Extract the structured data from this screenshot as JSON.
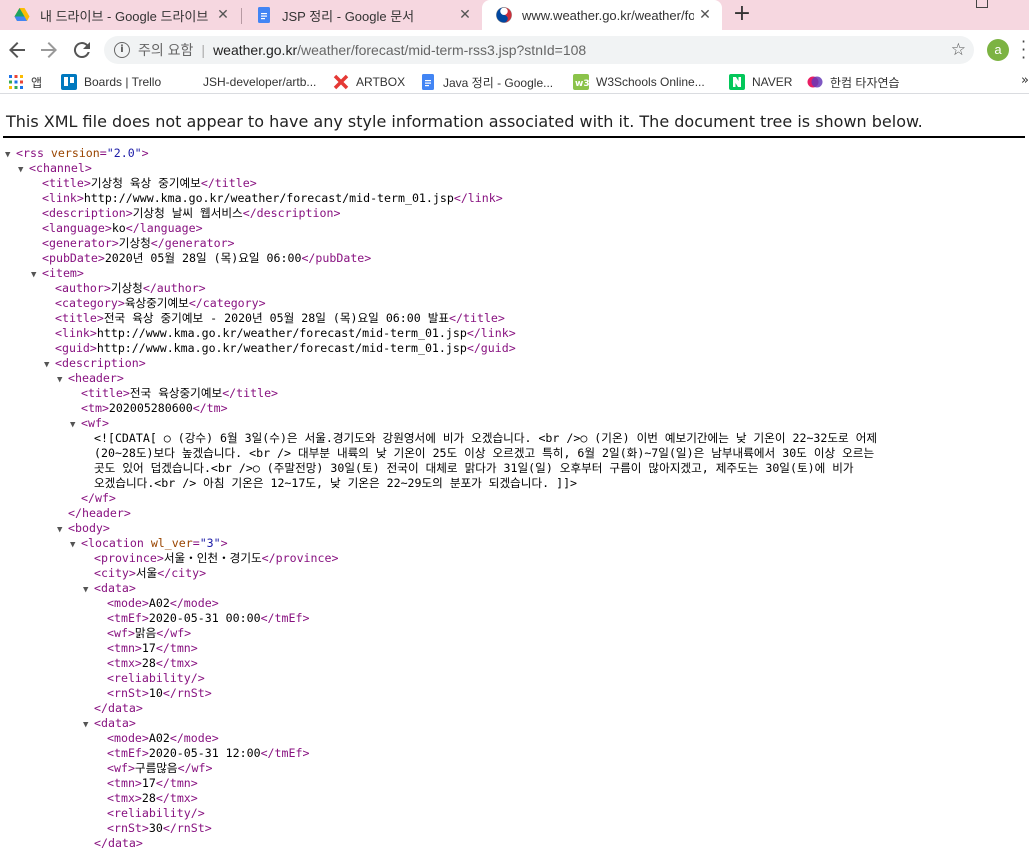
{
  "tabs": [
    {
      "title": "내 드라이브 - Google 드라이브",
      "icon": "google-drive-icon"
    },
    {
      "title": "JSP 정리 - Google 문서",
      "icon": "google-docs-icon"
    },
    {
      "title": "www.weather.go.kr/weather/fore",
      "icon": "chrome-page-icon"
    }
  ],
  "tab_close": "✕",
  "new_tab": "+",
  "omnibox": {
    "security_text": "주의 요함",
    "separator": "|",
    "host": "weather.go.kr",
    "path": "/weather/forecast/mid-term-rss3.jsp?stnId=108"
  },
  "profile_initial": "a",
  "bookmarks": [
    {
      "label": "앱",
      "icon": "apps-grid-icon"
    },
    {
      "label": "Boards | Trello",
      "icon": "trello-icon"
    },
    {
      "label": "JSH-developer/artb...",
      "icon": "github-icon"
    },
    {
      "label": "ARTBOX",
      "icon": "artbox-icon"
    },
    {
      "label": "Java 정리 - Google...",
      "icon": "google-docs-icon"
    },
    {
      "label": "W3Schools Online...",
      "icon": "w3schools-icon"
    },
    {
      "label": "NAVER",
      "icon": "naver-icon"
    },
    {
      "label": "한컴 타자연습",
      "icon": "hancom-icon"
    }
  ],
  "bookmarks_more": "»",
  "banner": "This XML file does not appear to have any style information associated with it. The document tree is shown below.",
  "xml_lines": [
    {
      "arrow": true,
      "indent": 0,
      "parts": [
        [
          "tg",
          "<rss "
        ],
        [
          "at",
          "version"
        ],
        [
          "tg",
          "="
        ],
        [
          "av",
          "\"2.0\""
        ],
        [
          "tg",
          ">"
        ]
      ]
    },
    {
      "arrow": true,
      "indent": 1,
      "parts": [
        [
          "tg",
          "<channel>"
        ]
      ]
    },
    {
      "arrow": false,
      "indent": 2,
      "parts": [
        [
          "tg",
          "<title>"
        ],
        [
          "tx",
          "기상청 육상 중기예보"
        ],
        [
          "tg",
          "</title>"
        ]
      ]
    },
    {
      "arrow": false,
      "indent": 2,
      "parts": [
        [
          "tg",
          "<link>"
        ],
        [
          "tx",
          "http://www.kma.go.kr/weather/forecast/mid-term_01.jsp"
        ],
        [
          "tg",
          "</link>"
        ]
      ]
    },
    {
      "arrow": false,
      "indent": 2,
      "parts": [
        [
          "tg",
          "<description>"
        ],
        [
          "tx",
          "기상청 날씨 웹서비스"
        ],
        [
          "tg",
          "</description>"
        ]
      ]
    },
    {
      "arrow": false,
      "indent": 2,
      "parts": [
        [
          "tg",
          "<language>"
        ],
        [
          "tx",
          "ko"
        ],
        [
          "tg",
          "</language>"
        ]
      ]
    },
    {
      "arrow": false,
      "indent": 2,
      "parts": [
        [
          "tg",
          "<generator>"
        ],
        [
          "tx",
          "기상청"
        ],
        [
          "tg",
          "</generator>"
        ]
      ]
    },
    {
      "arrow": false,
      "indent": 2,
      "parts": [
        [
          "tg",
          "<pubDate>"
        ],
        [
          "tx",
          "2020년 05월 28일 (목)요일 06:00"
        ],
        [
          "tg",
          "</pubDate>"
        ]
      ]
    },
    {
      "arrow": true,
      "indent": 2,
      "parts": [
        [
          "tg",
          "<item>"
        ]
      ]
    },
    {
      "arrow": false,
      "indent": 3,
      "parts": [
        [
          "tg",
          "<author>"
        ],
        [
          "tx",
          "기상청"
        ],
        [
          "tg",
          "</author>"
        ]
      ]
    },
    {
      "arrow": false,
      "indent": 3,
      "parts": [
        [
          "tg",
          "<category>"
        ],
        [
          "tx",
          "육상중기예보"
        ],
        [
          "tg",
          "</category>"
        ]
      ]
    },
    {
      "arrow": false,
      "indent": 3,
      "parts": [
        [
          "tg",
          "<title>"
        ],
        [
          "tx",
          "전국 육상 중기예보 - 2020년 05월 28일 (목)요일 06:00 발표"
        ],
        [
          "tg",
          "</title>"
        ]
      ]
    },
    {
      "arrow": false,
      "indent": 3,
      "parts": [
        [
          "tg",
          "<link>"
        ],
        [
          "tx",
          "http://www.kma.go.kr/weather/forecast/mid-term_01.jsp"
        ],
        [
          "tg",
          "</link>"
        ]
      ]
    },
    {
      "arrow": false,
      "indent": 3,
      "parts": [
        [
          "tg",
          "<guid>"
        ],
        [
          "tx",
          "http://www.kma.go.kr/weather/forecast/mid-term_01.jsp"
        ],
        [
          "tg",
          "</guid>"
        ]
      ]
    },
    {
      "arrow": true,
      "indent": 3,
      "parts": [
        [
          "tg",
          "<description>"
        ]
      ]
    },
    {
      "arrow": true,
      "indent": 4,
      "parts": [
        [
          "tg",
          "<header>"
        ]
      ]
    },
    {
      "arrow": false,
      "indent": 5,
      "parts": [
        [
          "tg",
          "<title>"
        ],
        [
          "tx",
          "전국 육상중기예보"
        ],
        [
          "tg",
          "</title>"
        ]
      ]
    },
    {
      "arrow": false,
      "indent": 5,
      "parts": [
        [
          "tg",
          "<tm>"
        ],
        [
          "tx",
          "202005280600"
        ],
        [
          "tg",
          "</tm>"
        ]
      ]
    },
    {
      "arrow": true,
      "indent": 5,
      "parts": [
        [
          "tg",
          "<wf>"
        ]
      ]
    },
    {
      "arrow": false,
      "indent": 6,
      "parts": [
        [
          "tx",
          "<![CDATA[ ○ (강수) 6월 3일(수)은 서울.경기도와 강원영서에 비가 오겠습니다. <br />○ (기온) 이번 예보기간에는 낮 기온이 22~32도로 어제"
        ]
      ]
    },
    {
      "arrow": false,
      "indent": 6,
      "parts": [
        [
          "tx",
          "(20~28도)보다 높겠습니다. <br /> 대부분 내륙의 낮 기온이 25도 이상 오르겠고 특히, 6월 2일(화)~7일(일)은 남부내륙에서 30도 이상 오르는"
        ]
      ]
    },
    {
      "arrow": false,
      "indent": 6,
      "parts": [
        [
          "tx",
          "곳도 있어 덥겠습니다.<br />○ (주말전망) 30일(토) 전국이 대체로 맑다가 31일(일) 오후부터 구름이 많아지겠고, 제주도는 30일(토)에 비가"
        ]
      ]
    },
    {
      "arrow": false,
      "indent": 6,
      "parts": [
        [
          "tx",
          "오겠습니다.<br /> 아침 기온은 12~17도, 낮 기온은 22~29도의 분포가 되겠습니다. ]]>"
        ]
      ]
    },
    {
      "arrow": false,
      "indent": 5,
      "parts": [
        [
          "tg",
          "</wf>"
        ]
      ]
    },
    {
      "arrow": false,
      "indent": 4,
      "parts": [
        [
          "tg",
          "</header>"
        ]
      ]
    },
    {
      "arrow": true,
      "indent": 4,
      "parts": [
        [
          "tg",
          "<body>"
        ]
      ]
    },
    {
      "arrow": true,
      "indent": 5,
      "parts": [
        [
          "tg",
          "<location "
        ],
        [
          "at",
          "wl_ver"
        ],
        [
          "tg",
          "="
        ],
        [
          "av",
          "\"3\""
        ],
        [
          "tg",
          ">"
        ]
      ]
    },
    {
      "arrow": false,
      "indent": 6,
      "parts": [
        [
          "tg",
          "<province>"
        ],
        [
          "tx",
          "서울・인천・경기도"
        ],
        [
          "tg",
          "</province>"
        ]
      ]
    },
    {
      "arrow": false,
      "indent": 6,
      "parts": [
        [
          "tg",
          "<city>"
        ],
        [
          "tx",
          "서울"
        ],
        [
          "tg",
          "</city>"
        ]
      ]
    },
    {
      "arrow": true,
      "indent": 6,
      "parts": [
        [
          "tg",
          "<data>"
        ]
      ]
    },
    {
      "arrow": false,
      "indent": 7,
      "parts": [
        [
          "tg",
          "<mode>"
        ],
        [
          "tx",
          "A02"
        ],
        [
          "tg",
          "</mode>"
        ]
      ]
    },
    {
      "arrow": false,
      "indent": 7,
      "parts": [
        [
          "tg",
          "<tmEf>"
        ],
        [
          "tx",
          "2020-05-31 00:00"
        ],
        [
          "tg",
          "</tmEf>"
        ]
      ]
    },
    {
      "arrow": false,
      "indent": 7,
      "parts": [
        [
          "tg",
          "<wf>"
        ],
        [
          "tx",
          "맑음"
        ],
        [
          "tg",
          "</wf>"
        ]
      ]
    },
    {
      "arrow": false,
      "indent": 7,
      "parts": [
        [
          "tg",
          "<tmn>"
        ],
        [
          "tx",
          "17"
        ],
        [
          "tg",
          "</tmn>"
        ]
      ]
    },
    {
      "arrow": false,
      "indent": 7,
      "parts": [
        [
          "tg",
          "<tmx>"
        ],
        [
          "tx",
          "28"
        ],
        [
          "tg",
          "</tmx>"
        ]
      ]
    },
    {
      "arrow": false,
      "indent": 7,
      "parts": [
        [
          "tg",
          "<reliability/>"
        ]
      ]
    },
    {
      "arrow": false,
      "indent": 7,
      "parts": [
        [
          "tg",
          "<rnSt>"
        ],
        [
          "tx",
          "10"
        ],
        [
          "tg",
          "</rnSt>"
        ]
      ]
    },
    {
      "arrow": false,
      "indent": 6,
      "parts": [
        [
          "tg",
          "</data>"
        ]
      ]
    },
    {
      "arrow": true,
      "indent": 6,
      "parts": [
        [
          "tg",
          "<data>"
        ]
      ]
    },
    {
      "arrow": false,
      "indent": 7,
      "parts": [
        [
          "tg",
          "<mode>"
        ],
        [
          "tx",
          "A02"
        ],
        [
          "tg",
          "</mode>"
        ]
      ]
    },
    {
      "arrow": false,
      "indent": 7,
      "parts": [
        [
          "tg",
          "<tmEf>"
        ],
        [
          "tx",
          "2020-05-31 12:00"
        ],
        [
          "tg",
          "</tmEf>"
        ]
      ]
    },
    {
      "arrow": false,
      "indent": 7,
      "parts": [
        [
          "tg",
          "<wf>"
        ],
        [
          "tx",
          "구름많음"
        ],
        [
          "tg",
          "</wf>"
        ]
      ]
    },
    {
      "arrow": false,
      "indent": 7,
      "parts": [
        [
          "tg",
          "<tmn>"
        ],
        [
          "tx",
          "17"
        ],
        [
          "tg",
          "</tmn>"
        ]
      ]
    },
    {
      "arrow": false,
      "indent": 7,
      "parts": [
        [
          "tg",
          "<tmx>"
        ],
        [
          "tx",
          "28"
        ],
        [
          "tg",
          "</tmx>"
        ]
      ]
    },
    {
      "arrow": false,
      "indent": 7,
      "parts": [
        [
          "tg",
          "<reliability/>"
        ]
      ]
    },
    {
      "arrow": false,
      "indent": 7,
      "parts": [
        [
          "tg",
          "<rnSt>"
        ],
        [
          "tx",
          "30"
        ],
        [
          "tg",
          "</rnSt>"
        ]
      ]
    },
    {
      "arrow": false,
      "indent": 6,
      "parts": [
        [
          "tg",
          "</data>"
        ]
      ]
    }
  ]
}
